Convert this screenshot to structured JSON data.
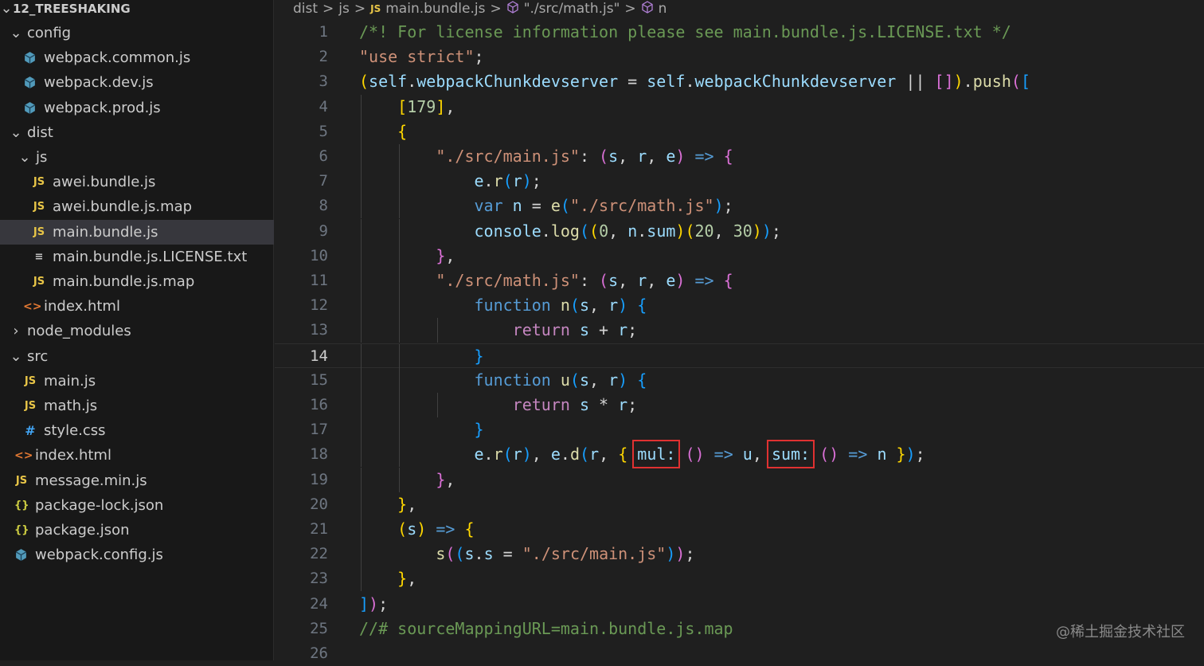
{
  "explorer": {
    "root": "12_TREESHAKING",
    "items": [
      {
        "label": "config",
        "type": "folder",
        "open": true,
        "depth": 0
      },
      {
        "label": "webpack.common.js",
        "type": "cube",
        "depth": 1
      },
      {
        "label": "webpack.dev.js",
        "type": "cube",
        "depth": 1
      },
      {
        "label": "webpack.prod.js",
        "type": "cube",
        "depth": 1
      },
      {
        "label": "dist",
        "type": "folder",
        "open": true,
        "depth": 0
      },
      {
        "label": "js",
        "type": "folder",
        "open": true,
        "depth": 1
      },
      {
        "label": "awei.bundle.js",
        "type": "js",
        "depth": 2
      },
      {
        "label": "awei.bundle.js.map",
        "type": "js",
        "depth": 2
      },
      {
        "label": "main.bundle.js",
        "type": "js",
        "depth": 2,
        "selected": true
      },
      {
        "label": "main.bundle.js.LICENSE.txt",
        "type": "txt",
        "depth": 2
      },
      {
        "label": "main.bundle.js.map",
        "type": "js",
        "depth": 2
      },
      {
        "label": "index.html",
        "type": "html",
        "depth": 1
      },
      {
        "label": "node_modules",
        "type": "folder",
        "open": false,
        "depth": 0
      },
      {
        "label": "src",
        "type": "folder",
        "open": true,
        "depth": 0
      },
      {
        "label": "main.js",
        "type": "js",
        "depth": 1
      },
      {
        "label": "math.js",
        "type": "js",
        "depth": 1
      },
      {
        "label": "style.css",
        "type": "css",
        "depth": 1
      },
      {
        "label": "index.html",
        "type": "html",
        "depth": 0
      },
      {
        "label": "message.min.js",
        "type": "js",
        "depth": 0
      },
      {
        "label": "package-lock.json",
        "type": "json",
        "depth": 0
      },
      {
        "label": "package.json",
        "type": "json",
        "depth": 0
      },
      {
        "label": "webpack.config.js",
        "type": "cube",
        "depth": 0
      }
    ]
  },
  "breadcrumb": {
    "parts": [
      "dist",
      "js",
      "main.bundle.js",
      "\"./src/math.js\"",
      "n"
    ],
    "js_badge": "JS"
  },
  "icons": {
    "js": "JS",
    "html": "<>",
    "css": "#",
    "json": "{}",
    "txt": "≡",
    "cube": "cube-icon",
    "folder": "chevron-icon"
  },
  "editor": {
    "current_line": 14,
    "lines": [
      [
        [
          "c",
          "/*! For license information please see main.bundle.js.LICENSE.txt */"
        ]
      ],
      [
        [
          "s",
          "\"use strict\""
        ],
        [
          "p",
          ";"
        ]
      ],
      [
        [
          "b1",
          "("
        ],
        [
          "v",
          "self"
        ],
        [
          "p",
          "."
        ],
        [
          "v",
          "webpackChunkdevserver"
        ],
        [
          "p",
          " = "
        ],
        [
          "v",
          "self"
        ],
        [
          "p",
          "."
        ],
        [
          "v",
          "webpackChunkdevserver"
        ],
        [
          "p",
          " || "
        ],
        [
          "b2",
          "[]"
        ],
        [
          "b1",
          ")"
        ],
        [
          "p",
          "."
        ],
        [
          "f",
          "push"
        ],
        [
          "b2",
          "("
        ],
        [
          "b3",
          "["
        ]
      ],
      [
        [
          "p",
          "    "
        ],
        [
          "b1",
          "["
        ],
        [
          "n",
          "179"
        ],
        [
          "b1",
          "]"
        ],
        [
          "p",
          ","
        ]
      ],
      [
        [
          "p",
          "    "
        ],
        [
          "b1",
          "{"
        ]
      ],
      [
        [
          "p",
          "        "
        ],
        [
          "s",
          "\"./src/main.js\""
        ],
        [
          "p",
          ": "
        ],
        [
          "b2",
          "("
        ],
        [
          "v",
          "s"
        ],
        [
          "p",
          ", "
        ],
        [
          "v",
          "r"
        ],
        [
          "p",
          ", "
        ],
        [
          "v",
          "e"
        ],
        [
          "b2",
          ")"
        ],
        [
          "p",
          " "
        ],
        [
          "k",
          "=>"
        ],
        [
          "p",
          " "
        ],
        [
          "b2",
          "{"
        ]
      ],
      [
        [
          "p",
          "            "
        ],
        [
          "v",
          "e"
        ],
        [
          "p",
          "."
        ],
        [
          "f",
          "r"
        ],
        [
          "b3",
          "("
        ],
        [
          "v",
          "r"
        ],
        [
          "b3",
          ")"
        ],
        [
          "p",
          ";"
        ]
      ],
      [
        [
          "p",
          "            "
        ],
        [
          "k",
          "var"
        ],
        [
          "p",
          " "
        ],
        [
          "v",
          "n"
        ],
        [
          "p",
          " = "
        ],
        [
          "f",
          "e"
        ],
        [
          "b3",
          "("
        ],
        [
          "s",
          "\"./src/math.js\""
        ],
        [
          "b3",
          ")"
        ],
        [
          "p",
          ";"
        ]
      ],
      [
        [
          "p",
          "            "
        ],
        [
          "v",
          "console"
        ],
        [
          "p",
          "."
        ],
        [
          "f",
          "log"
        ],
        [
          "b3",
          "("
        ],
        [
          "b1",
          "("
        ],
        [
          "n",
          "0"
        ],
        [
          "p",
          ", "
        ],
        [
          "v",
          "n"
        ],
        [
          "p",
          "."
        ],
        [
          "v",
          "sum"
        ],
        [
          "b1",
          ")"
        ],
        [
          "b1",
          "("
        ],
        [
          "n",
          "20"
        ],
        [
          "p",
          ", "
        ],
        [
          "n",
          "30"
        ],
        [
          "b1",
          ")"
        ],
        [
          "b3",
          ")"
        ],
        [
          "p",
          ";"
        ]
      ],
      [
        [
          "p",
          "        "
        ],
        [
          "b2",
          "}"
        ],
        [
          "p",
          ","
        ]
      ],
      [
        [
          "p",
          "        "
        ],
        [
          "s",
          "\"./src/math.js\""
        ],
        [
          "p",
          ": "
        ],
        [
          "b2",
          "("
        ],
        [
          "v",
          "s"
        ],
        [
          "p",
          ", "
        ],
        [
          "v",
          "r"
        ],
        [
          "p",
          ", "
        ],
        [
          "v",
          "e"
        ],
        [
          "b2",
          ")"
        ],
        [
          "p",
          " "
        ],
        [
          "k",
          "=>"
        ],
        [
          "p",
          " "
        ],
        [
          "b2",
          "{"
        ]
      ],
      [
        [
          "p",
          "            "
        ],
        [
          "k",
          "function"
        ],
        [
          "p",
          " "
        ],
        [
          "f",
          "n"
        ],
        [
          "b3",
          "("
        ],
        [
          "v",
          "s"
        ],
        [
          "p",
          ", "
        ],
        [
          "v",
          "r"
        ],
        [
          "b3",
          ")"
        ],
        [
          "p",
          " "
        ],
        [
          "b3",
          "{"
        ]
      ],
      [
        [
          "p",
          "                "
        ],
        [
          "kc",
          "return"
        ],
        [
          "p",
          " "
        ],
        [
          "v",
          "s"
        ],
        [
          "p",
          " + "
        ],
        [
          "v",
          "r"
        ],
        [
          "p",
          ";"
        ]
      ],
      [
        [
          "p",
          "            "
        ],
        [
          "b3",
          "}"
        ]
      ],
      [
        [
          "p",
          "            "
        ],
        [
          "k",
          "function"
        ],
        [
          "p",
          " "
        ],
        [
          "f",
          "u"
        ],
        [
          "b3",
          "("
        ],
        [
          "v",
          "s"
        ],
        [
          "p",
          ", "
        ],
        [
          "v",
          "r"
        ],
        [
          "b3",
          ")"
        ],
        [
          "p",
          " "
        ],
        [
          "b3",
          "{"
        ]
      ],
      [
        [
          "p",
          "                "
        ],
        [
          "kc",
          "return"
        ],
        [
          "p",
          " "
        ],
        [
          "v",
          "s"
        ],
        [
          "p",
          " * "
        ],
        [
          "v",
          "r"
        ],
        [
          "p",
          ";"
        ]
      ],
      [
        [
          "p",
          "            "
        ],
        [
          "b3",
          "}"
        ]
      ],
      [
        [
          "p",
          "            "
        ],
        [
          "v",
          "e"
        ],
        [
          "p",
          "."
        ],
        [
          "f",
          "r"
        ],
        [
          "b3",
          "("
        ],
        [
          "v",
          "r"
        ],
        [
          "b3",
          ")"
        ],
        [
          "p",
          ", "
        ],
        [
          "v",
          "e"
        ],
        [
          "p",
          "."
        ],
        [
          "f",
          "d"
        ],
        [
          "b3",
          "("
        ],
        [
          "v",
          "r"
        ],
        [
          "p",
          ", "
        ],
        [
          "b1",
          "{"
        ],
        [
          "p",
          " "
        ],
        [
          "box",
          "mul:"
        ],
        [
          "p",
          " "
        ],
        [
          "b2",
          "()"
        ],
        [
          "p",
          " "
        ],
        [
          "k",
          "=>"
        ],
        [
          "p",
          " "
        ],
        [
          "v",
          "u"
        ],
        [
          "p",
          ", "
        ],
        [
          "box",
          "sum:"
        ],
        [
          "p",
          " "
        ],
        [
          "b2",
          "()"
        ],
        [
          "p",
          " "
        ],
        [
          "k",
          "=>"
        ],
        [
          "p",
          " "
        ],
        [
          "v",
          "n"
        ],
        [
          "p",
          " "
        ],
        [
          "b1",
          "}"
        ],
        [
          "b3",
          ")"
        ],
        [
          "p",
          ";"
        ]
      ],
      [
        [
          "p",
          "        "
        ],
        [
          "b2",
          "}"
        ],
        [
          "p",
          ","
        ]
      ],
      [
        [
          "p",
          "    "
        ],
        [
          "b1",
          "}"
        ],
        [
          "p",
          ","
        ]
      ],
      [
        [
          "p",
          "    "
        ],
        [
          "b1",
          "("
        ],
        [
          "v",
          "s"
        ],
        [
          "b1",
          ")"
        ],
        [
          "p",
          " "
        ],
        [
          "k",
          "=>"
        ],
        [
          "p",
          " "
        ],
        [
          "b1",
          "{"
        ]
      ],
      [
        [
          "p",
          "        "
        ],
        [
          "f",
          "s"
        ],
        [
          "b2",
          "("
        ],
        [
          "b3",
          "("
        ],
        [
          "v",
          "s"
        ],
        [
          "p",
          "."
        ],
        [
          "v",
          "s"
        ],
        [
          "p",
          " = "
        ],
        [
          "s",
          "\"./src/main.js\""
        ],
        [
          "b3",
          ")"
        ],
        [
          "b2",
          ")"
        ],
        [
          "p",
          ";"
        ]
      ],
      [
        [
          "p",
          "    "
        ],
        [
          "b1",
          "}"
        ],
        [
          "p",
          ","
        ]
      ],
      [
        [
          "b3",
          "]"
        ],
        [
          "b2",
          ")"
        ],
        [
          "p",
          ";"
        ]
      ],
      [
        [
          "c",
          "//# sourceMappingURL=main.bundle.js.map"
        ]
      ],
      []
    ]
  },
  "watermark": "@稀土掘金技术社区"
}
